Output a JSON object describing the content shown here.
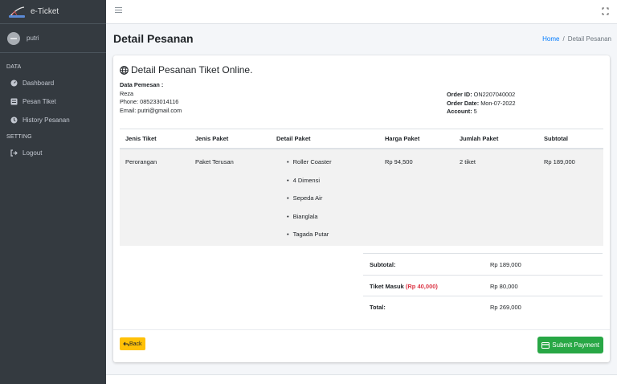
{
  "brand": {
    "name": "e-Ticket"
  },
  "user": {
    "name": "putri"
  },
  "sidebar": {
    "sections": [
      {
        "header": "DATA"
      },
      {
        "header": "SETTING"
      }
    ],
    "items": [
      {
        "label": "Dashboard",
        "icon": "tachometer-icon"
      },
      {
        "label": "Pesan Tiket",
        "icon": "list-icon"
      },
      {
        "label": "History Pesanan",
        "icon": "history-icon"
      },
      {
        "label": "Logout",
        "icon": "logout-icon"
      }
    ]
  },
  "header": {
    "title": "Detail Pesanan",
    "breadcrumb": {
      "home": "Home",
      "separator": "/",
      "current": "Detail Pesanan"
    }
  },
  "card": {
    "title": "Detail Pesanan Tiket Online.",
    "buyer": {
      "heading": "Data Pemesan :",
      "name": "Reza",
      "phone": "Phone: 085233014116",
      "email": "Email: putri@gmail.com"
    },
    "order": {
      "id_label": "Order ID:",
      "id_value": "ON2207040002",
      "date_label": "Order Date:",
      "date_value": "Mon-07-2022",
      "account_label": "Account:",
      "account_value": "5"
    },
    "table": {
      "headers": [
        "Jenis Tiket",
        "Jenis Paket",
        "Detail Paket",
        "Harga Paket",
        "Jumlah Paket",
        "Subtotal"
      ],
      "rows": [
        {
          "jenis_tiket": "Perorangan",
          "jenis_paket": "Paket Terusan",
          "detail_paket": [
            "Roller Coaster",
            "4 Dimensi",
            "Sepeda Air",
            "Bianglala",
            "Tagada Putar"
          ],
          "harga": "Rp 94,500",
          "jumlah": "2 tiket",
          "subtotal": "Rp 189,000"
        }
      ]
    },
    "totals": {
      "subtotal_label": "Subtotal:",
      "subtotal_value": "Rp 189,000",
      "tiket_masuk_label": "Tiket Masuk",
      "tiket_masuk_price": "(Rp 40,000)",
      "tiket_masuk_value": "Rp 80,000",
      "total_label": "Total:",
      "total_value": "Rp 269,000"
    },
    "buttons": {
      "back": "Back",
      "submit": "Submit Payment"
    }
  },
  "colors": {
    "sidebar": "#343a40",
    "primary": "#007bff",
    "warning": "#ffc107",
    "success": "#28a745",
    "danger": "#dc3545"
  }
}
